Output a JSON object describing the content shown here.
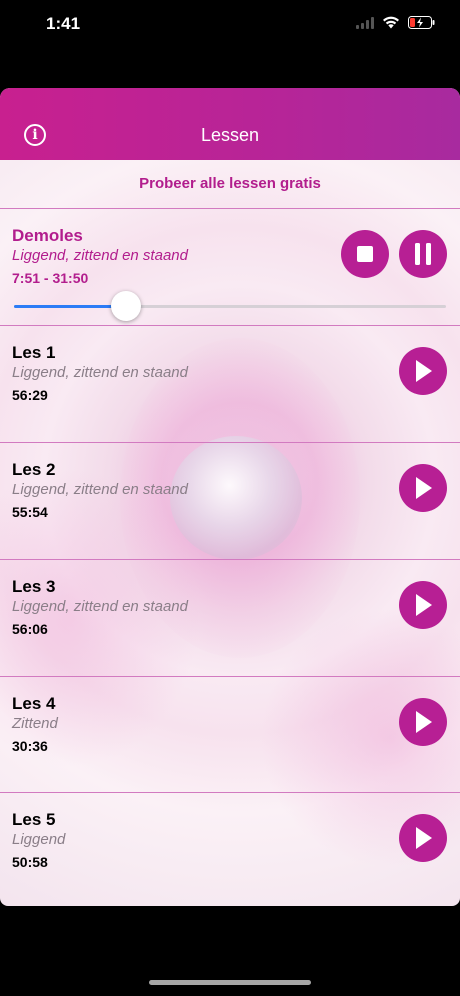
{
  "status_bar": {
    "time": "1:41"
  },
  "nav": {
    "title": "Lessen",
    "info_icon": "info-icon"
  },
  "free_link": "Probeer alle lessen gratis",
  "demo": {
    "title": "Demoles",
    "subtitle": "Liggend, zittend en staand",
    "time_range": "7:51 - 31:50",
    "progress": 0.26
  },
  "lessons": [
    {
      "title": "Les 1",
      "subtitle": "Liggend, zittend en staand",
      "duration": "56:29"
    },
    {
      "title": "Les 2",
      "subtitle": "Liggend, zittend en staand",
      "duration": "55:54"
    },
    {
      "title": "Les 3",
      "subtitle": "Liggend, zittend en staand",
      "duration": "56:06"
    },
    {
      "title": "Les 4",
      "subtitle": "Zittend",
      "duration": "30:36"
    },
    {
      "title": "Les 5",
      "subtitle": "Liggend",
      "duration": "50:58"
    }
  ],
  "colors": {
    "brand": "#b71f94",
    "progress": "#2c7cf6",
    "divider": "#d27ac0"
  }
}
